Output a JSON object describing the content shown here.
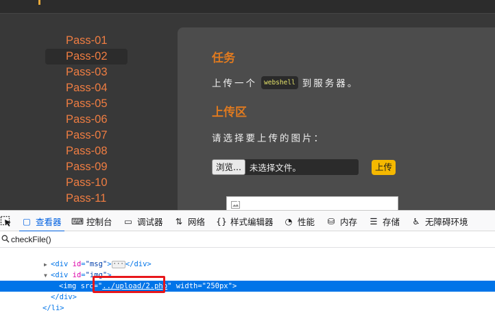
{
  "sidebar": {
    "items": [
      "Pass-01",
      "Pass-02",
      "Pass-03",
      "Pass-04",
      "Pass-05",
      "Pass-06",
      "Pass-07",
      "Pass-08",
      "Pass-09",
      "Pass-10",
      "Pass-11"
    ],
    "active_index": 1
  },
  "content": {
    "task_title": "任务",
    "task_desc_before": "上传一个",
    "task_code": "webshell",
    "task_desc_after": "到服务器。",
    "upload_title": "上传区",
    "choose_label": "请选择要上传的图片：",
    "browse_label": "浏览...",
    "file_status": "未选择文件。",
    "upload_button": "上传"
  },
  "devtools": {
    "tabs": [
      {
        "label": "查看器",
        "icon": "inspector-icon",
        "active": true
      },
      {
        "label": "控制台",
        "icon": "console-icon"
      },
      {
        "label": "调试器",
        "icon": "debugger-icon"
      },
      {
        "label": "网络",
        "icon": "network-icon"
      },
      {
        "label": "样式编辑器",
        "icon": "style-editor-icon"
      },
      {
        "label": "性能",
        "icon": "performance-icon"
      },
      {
        "label": "内存",
        "icon": "memory-icon"
      },
      {
        "label": "存储",
        "icon": "storage-icon"
      },
      {
        "label": "无障碍环境",
        "icon": "accessibility-icon"
      }
    ],
    "search_value": "checkFile()",
    "markup": {
      "line1": {
        "tag_open": "<div",
        "attr": "id",
        "val": "\"msg\"",
        "tag_close": "></div>"
      },
      "line2": {
        "tag_open": "<div",
        "attr": "id",
        "val": "\"img\"",
        "tag_close": ">"
      },
      "line3": {
        "tag_open": "<img",
        "attr_src": "src",
        "src_q1": "\"",
        "src_val": "../upload/2.php",
        "src_q2": "\"",
        "attr_width": "width",
        "width_val": "\"250px\"",
        "tag_close": ">"
      },
      "line4": "</div>",
      "line5": "</li>"
    }
  },
  "colors": {
    "accent_orange": "#ef7d42",
    "title_orange": "#e07a1f",
    "upload_yellow": "#f5b800",
    "devtools_blue": "#0074e8",
    "highlight_red": "#e8161a"
  }
}
